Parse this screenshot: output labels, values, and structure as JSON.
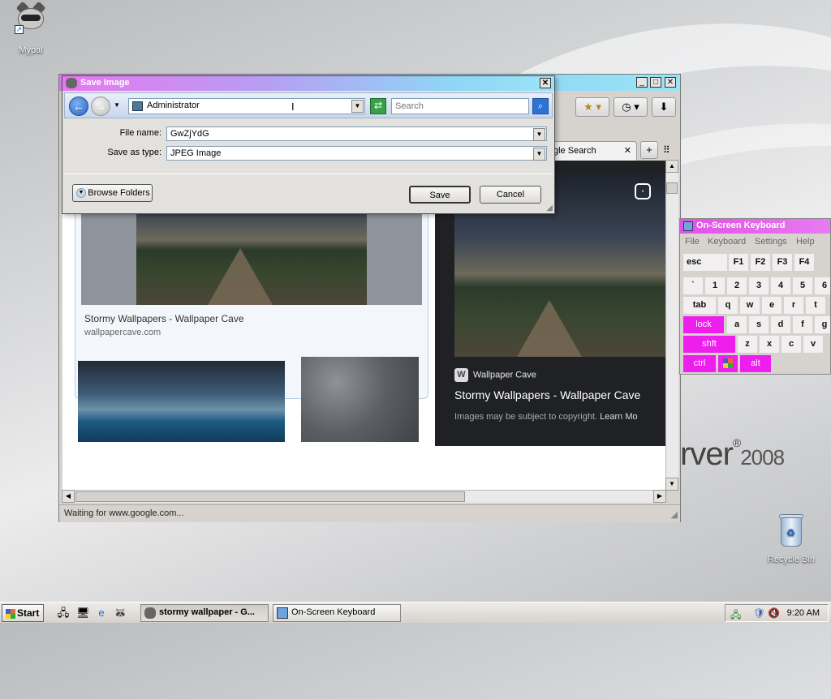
{
  "desktop": {
    "icon_mypal": "Mypal",
    "icon_recycle": "Recycle Bin",
    "watermark_main": "rver",
    "watermark_year": "2008"
  },
  "browser": {
    "tab_label": "gle Search",
    "status": "Waiting for www.google.com...",
    "results": {
      "card1_title": "Stormy Wallpapers - Wallpaper Cave",
      "card1_source": "wallpapercave.com"
    },
    "preview": {
      "source": "Wallpaper Cave",
      "source_letter": "W",
      "title": "Stormy Wallpapers - Wallpaper Cave",
      "copyright": "Images may be subject to copyright.",
      "learn_more": "Learn Mo"
    }
  },
  "dialog": {
    "title": "Save Image",
    "location": "Administrator",
    "search_placeholder": "Search",
    "file_name_label": "File name:",
    "file_name_value": "GwZjYdG",
    "save_type_label": "Save as type:",
    "save_type_value": "JPEG Image",
    "browse_folders": "Browse Folders",
    "save": "Save",
    "cancel": "Cancel"
  },
  "osk": {
    "title": "On-Screen Keyboard",
    "menu": [
      "File",
      "Keyboard",
      "Settings",
      "Help"
    ],
    "row1": [
      "esc",
      "F1",
      "F2",
      "F3",
      "F4"
    ],
    "row2": [
      "`",
      "1",
      "2",
      "3",
      "4",
      "5",
      "6"
    ],
    "row3": [
      "tab",
      "q",
      "w",
      "e",
      "r",
      "t"
    ],
    "row4": [
      "lock",
      "a",
      "s",
      "d",
      "f",
      "g"
    ],
    "row5": [
      "shft",
      "z",
      "x",
      "c",
      "v"
    ],
    "row6": [
      "ctrl",
      "alt"
    ]
  },
  "taskbar": {
    "start": "Start",
    "task1": "stormy wallpaper - G...",
    "task2": "On-Screen Keyboard",
    "clock": "9:20 AM"
  },
  "colors": {
    "title_gradient_start": "#e877f2",
    "title_gradient_end": "#9ae3f7",
    "osk_accent": "#ee1fee",
    "dark_panel": "#202124"
  }
}
